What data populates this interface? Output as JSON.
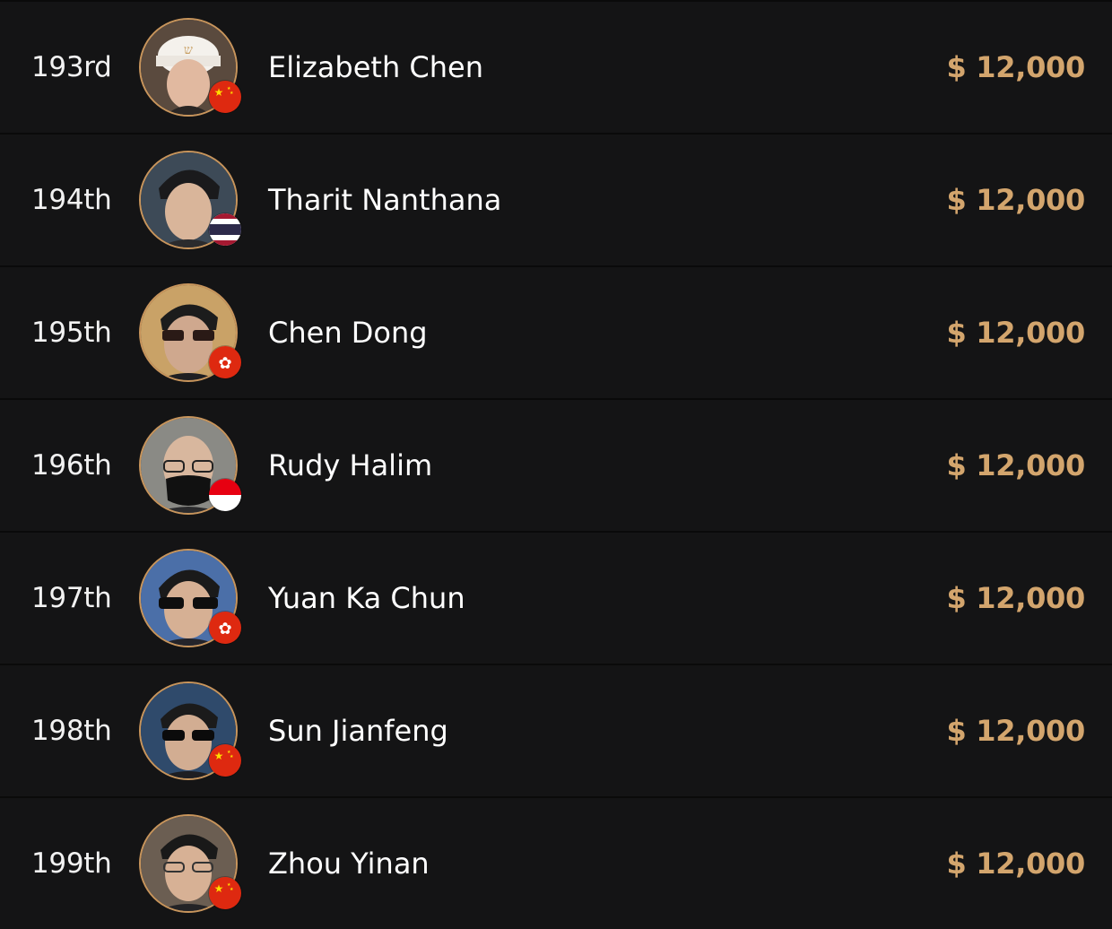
{
  "accent_color": "#d3a56d",
  "players": [
    {
      "rank": "193rd",
      "name": "Elizabeth Chen",
      "prize": "$ 12,000",
      "flag": "china-flag",
      "avatar": "player-photo"
    },
    {
      "rank": "194th",
      "name": "Tharit Nanthana",
      "prize": "$ 12,000",
      "flag": "thailand-flag",
      "avatar": "player-photo"
    },
    {
      "rank": "195th",
      "name": "Chen Dong",
      "prize": "$ 12,000",
      "flag": "hong-kong-flag",
      "avatar": "player-photo"
    },
    {
      "rank": "196th",
      "name": "Rudy Halim",
      "prize": "$ 12,000",
      "flag": "indonesia-flag",
      "avatar": "player-photo"
    },
    {
      "rank": "197th",
      "name": "Yuan Ka Chun",
      "prize": "$ 12,000",
      "flag": "hong-kong-flag",
      "avatar": "player-photo"
    },
    {
      "rank": "198th",
      "name": "Sun Jianfeng",
      "prize": "$ 12,000",
      "flag": "china-flag",
      "avatar": "player-photo"
    },
    {
      "rank": "199th",
      "name": "Zhou Yinan",
      "prize": "$ 12,000",
      "flag": "china-flag",
      "avatar": "player-photo"
    }
  ]
}
